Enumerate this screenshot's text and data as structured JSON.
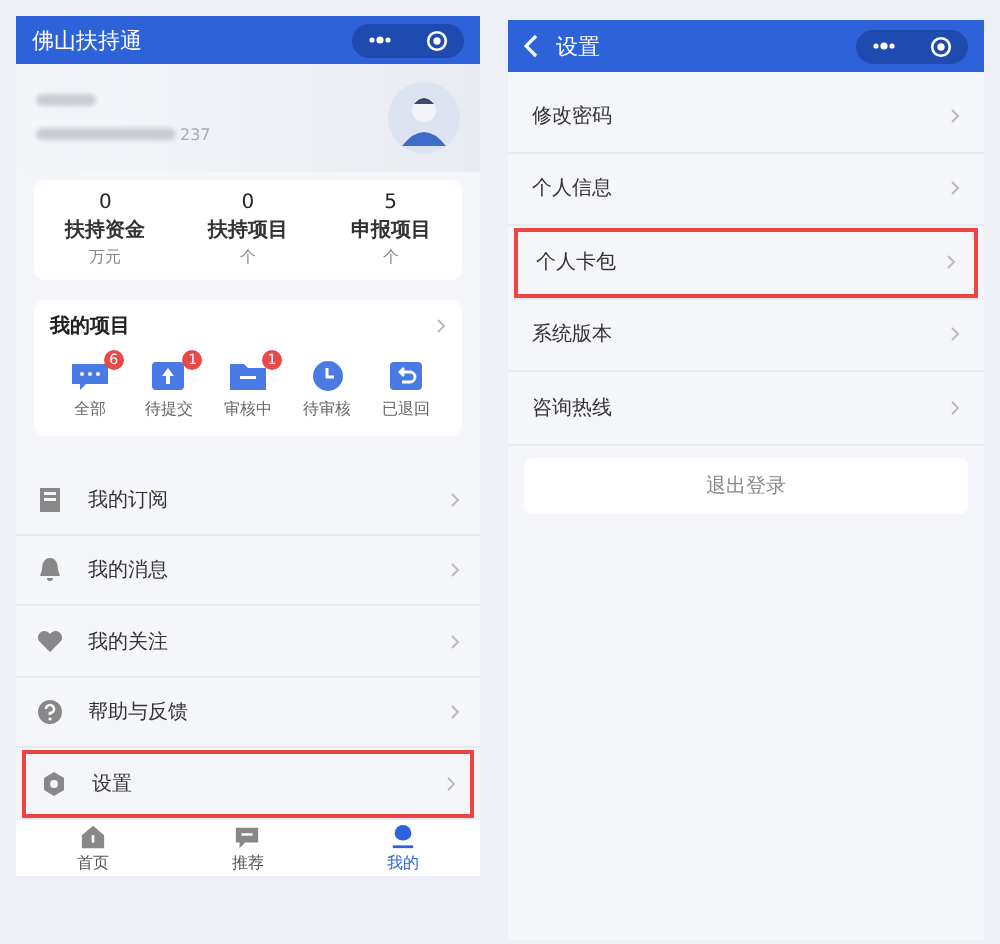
{
  "left": {
    "title": "佛山扶持通",
    "profile": {
      "phone_tail": "237"
    },
    "stats": [
      {
        "value": "0",
        "label": "扶持资金",
        "unit": "万元"
      },
      {
        "value": "0",
        "label": "扶持项目",
        "unit": "个"
      },
      {
        "value": "5",
        "label": "申报项目",
        "unit": "个"
      }
    ],
    "projects": {
      "title": "我的项目",
      "items": [
        {
          "label": "全部",
          "kind": "chat",
          "badge": "6"
        },
        {
          "label": "待提交",
          "kind": "upload",
          "badge": "1"
        },
        {
          "label": "审核中",
          "kind": "folder",
          "badge": "1"
        },
        {
          "label": "待审核",
          "kind": "clock"
        },
        {
          "label": "已退回",
          "kind": "return"
        }
      ]
    },
    "menu": [
      {
        "label": "我的订阅",
        "kind": "book",
        "highlighted": false
      },
      {
        "label": "我的消息",
        "kind": "bell",
        "highlighted": false
      },
      {
        "label": "我的关注",
        "kind": "heart",
        "highlighted": false
      },
      {
        "label": "帮助与反馈",
        "kind": "help",
        "highlighted": false
      },
      {
        "label": "设置",
        "kind": "gear",
        "highlighted": true
      }
    ],
    "tabs": [
      {
        "label": "首页",
        "kind": "home",
        "selected": false
      },
      {
        "label": "推荐",
        "kind": "chat",
        "selected": false
      },
      {
        "label": "我的",
        "kind": "user",
        "selected": true
      }
    ]
  },
  "right": {
    "title": "设置",
    "menu": [
      {
        "label": "修改密码",
        "highlighted": false
      },
      {
        "label": "个人信息",
        "highlighted": false
      },
      {
        "label": "个人卡包",
        "highlighted": true
      },
      {
        "label": "系统版本",
        "highlighted": false
      },
      {
        "label": "咨询热线",
        "highlighted": false
      }
    ],
    "logout": "退出登录"
  }
}
